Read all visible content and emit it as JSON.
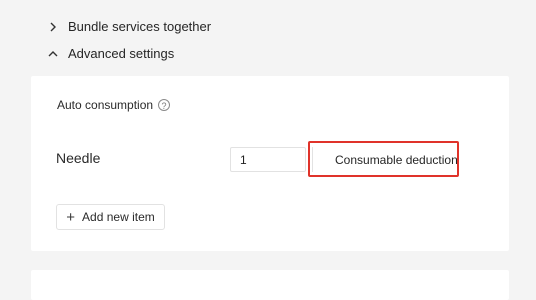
{
  "sections": {
    "bundle": {
      "label": "Bundle services together",
      "icon": "chevron-right-icon"
    },
    "advanced": {
      "label": "Advanced settings",
      "icon": "chevron-up-icon"
    }
  },
  "auto_consumption": {
    "label": "Auto consumption",
    "help_icon": "question-circle-icon",
    "items": [
      {
        "name": "Needle",
        "quantity": "1",
        "deduction_label": "Consumable deduction"
      }
    ],
    "add_button_label": "Add new item"
  },
  "colors": {
    "background": "#f4f4f4",
    "card": "#ffffff",
    "highlight_border": "#e0332a"
  }
}
